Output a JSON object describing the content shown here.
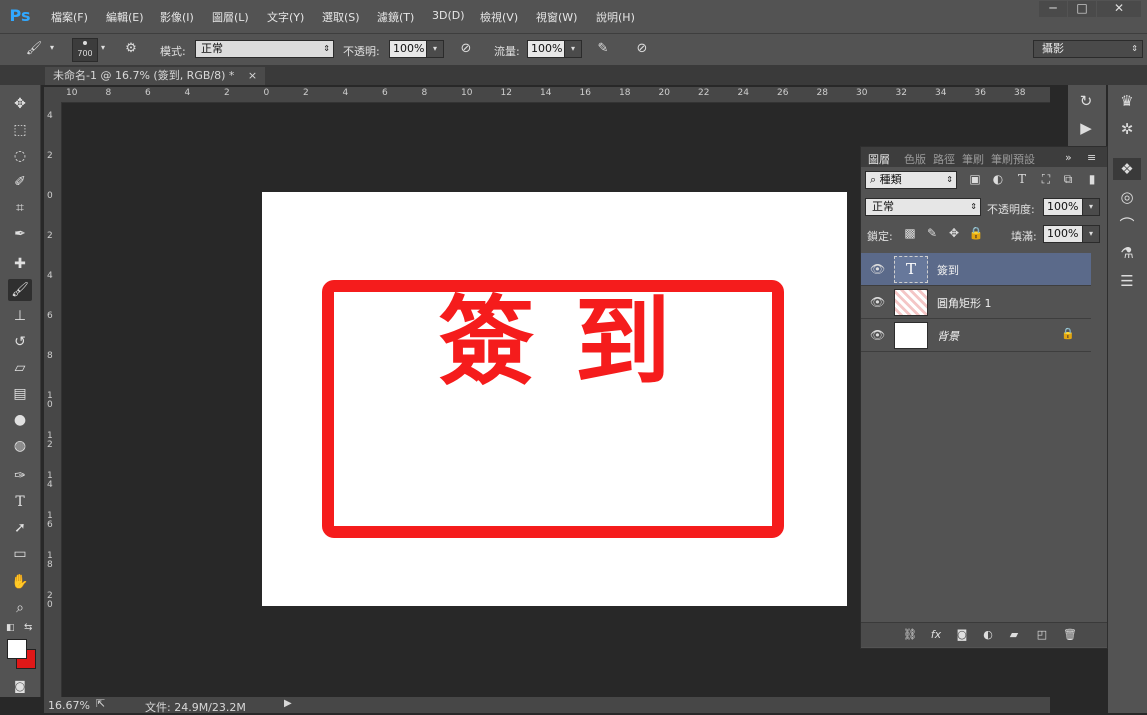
{
  "app": {
    "logo": "Ps"
  },
  "menu": [
    "檔案(F)",
    "編輯(E)",
    "影像(I)",
    "圖層(L)",
    "文字(Y)",
    "選取(S)",
    "濾鏡(T)",
    "3D(D)",
    "檢視(V)",
    "視窗(W)",
    "說明(H)"
  ],
  "window_controls": [
    "─",
    "□",
    "✕"
  ],
  "options": {
    "brush_size": "700",
    "mode_label": "模式:",
    "mode_value": "正常",
    "opacity_label": "不透明:",
    "opacity_value": "100%",
    "flow_label": "流量:",
    "flow_value": "100%",
    "workspace": "攝影"
  },
  "document_tab": {
    "title": "未命名-1 @ 16.7% (簽到, RGB/8) *",
    "close": "×"
  },
  "ruler": {
    "h_ticks": [
      "10",
      "8",
      "6",
      "4",
      "2",
      "0",
      "2",
      "4",
      "6",
      "8",
      "10",
      "12",
      "14",
      "16",
      "18",
      "20",
      "22",
      "24",
      "26",
      "28",
      "30",
      "32",
      "34",
      "36",
      "38"
    ],
    "v_ticks": [
      "4",
      "2",
      "0",
      "2",
      "4",
      "6",
      "8",
      "1\n0",
      "1\n2",
      "1\n4",
      "1\n6",
      "1\n8",
      "2\n0"
    ]
  },
  "canvas": {
    "stamp_text": "簽到",
    "stamp_color": "#f51c1c",
    "background": "#ffffff"
  },
  "status": {
    "zoom": "16.67%",
    "doc_size": "文件: 24.9M/23.2M"
  },
  "layers_panel": {
    "tabs": [
      "圖層",
      "色版",
      "路徑",
      "筆刷",
      "筆刷預設"
    ],
    "filter_kind": "種類",
    "blend_mode": "正常",
    "opacity_label": "不透明度:",
    "opacity_value": "100%",
    "lock_label": "鎖定:",
    "fill_label": "填滿:",
    "fill_value": "100%",
    "layers": [
      {
        "name": "簽到",
        "type": "text",
        "selected": true
      },
      {
        "name": "圓角矩形 1",
        "type": "shape",
        "selected": false
      },
      {
        "name": "背景",
        "type": "background",
        "selected": false,
        "locked": true
      }
    ]
  },
  "colors": {
    "accent_selection": "#5b6a8a",
    "foreground": "#ffffff",
    "background": "#e01818"
  }
}
